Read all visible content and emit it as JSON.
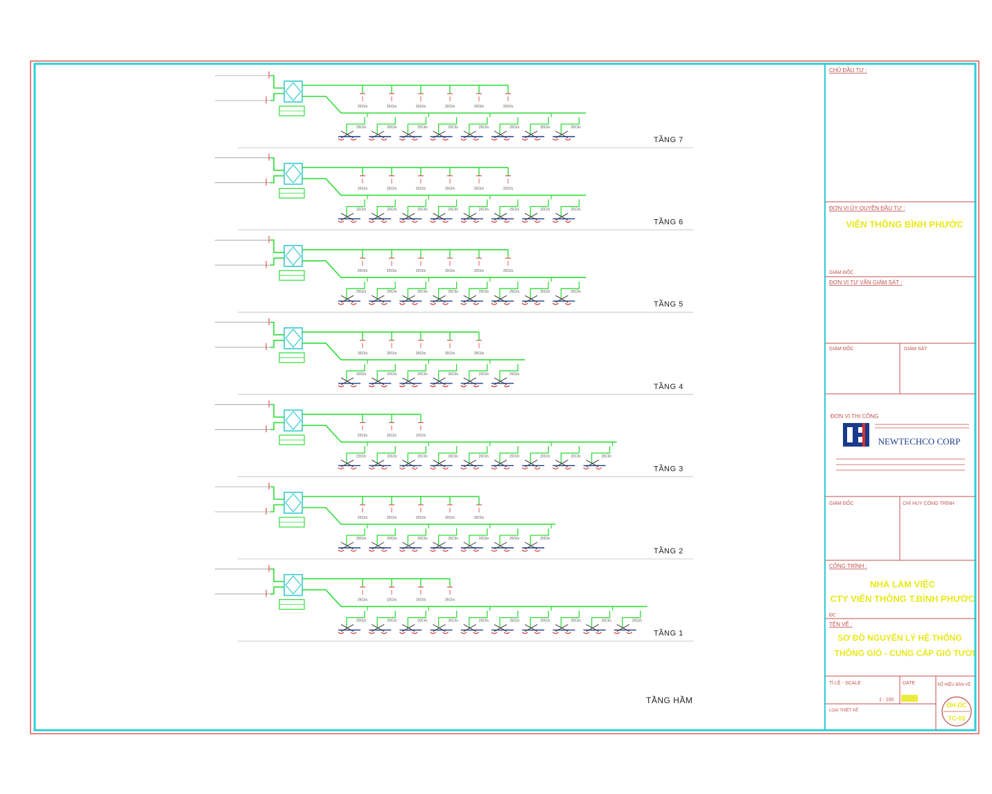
{
  "floors": [
    {
      "label": "TẦNG 7",
      "top_tees": [
        "20Cl/s",
        "20Cl/s",
        "20Cl/s",
        "20Cl/s",
        "20Cl/s",
        "20Cl/s"
      ],
      "bottom_labels": [
        "25Cl/s",
        "25Cl/s",
        "25Cl/s",
        "25Cl/s",
        "25Cl/s",
        "25Cl/s",
        "25Cl/s",
        "25Cl/s"
      ]
    },
    {
      "label": "TẦNG 6",
      "top_tees": [
        "20Cl/s",
        "20Cl/s",
        "20Cl/s",
        "20Cl/s",
        "20Cl/s",
        "20Cl/s"
      ],
      "bottom_labels": [
        "25Cl/s",
        "25Cl/s",
        "25Cl/s",
        "25Cl/s",
        "25Cl/s",
        "25Cl/s",
        "25Cl/s",
        "25Cl/s"
      ]
    },
    {
      "label": "TẦNG 5",
      "top_tees": [
        "20Cl/s",
        "20Cl/s",
        "20Cl/s",
        "20Cl/s",
        "20Cl/s",
        "20Cl/s"
      ],
      "bottom_labels": [
        "25Cl/s",
        "25Cl/s",
        "25Cl/s",
        "25Cl/s",
        "25Cl/s",
        "25Cl/s",
        "25Cl/s",
        "25Cl/s"
      ]
    },
    {
      "label": "TẦNG 4",
      "top_tees": [
        "20Cl/s",
        "20Cl/s",
        "20Cl/s",
        "20Cl/s",
        "20Cl/s"
      ],
      "bottom_labels": [
        "20Cl/s",
        "20Cl/s",
        "20Cl/s",
        "20Cl/s",
        "20Cl/s",
        "20Cl/s"
      ]
    },
    {
      "label": "TẦNG 3",
      "top_tees": [
        "20Cl/s",
        "20Cl/s",
        "10Cl/s"
      ],
      "bottom_labels": [
        "20Cl/s",
        "20Cl/s",
        "20Cl/s",
        "20Cl/s",
        "20Cl/s",
        "20Cl/s",
        "20Cl/s",
        "20Cl/s",
        "20Cl/s"
      ]
    },
    {
      "label": "TẦNG 2",
      "top_tees": [
        "20Cl/s",
        "20Cl/s",
        "20Cl/s",
        "20Cl/s",
        "20Cl/s"
      ],
      "bottom_labels": [
        "20Cl/s",
        "20Cl/s",
        "20Cl/s",
        "25Cl/s",
        "20Cl/s",
        "20Cl/s",
        "20Cl/s"
      ]
    },
    {
      "label": "TẦNG 1",
      "top_tees": [
        "25Cl/s",
        "10Cl/s",
        "10Cl/s",
        "25Cl/s"
      ],
      "bottom_labels": [
        "20Cl/s",
        "20Cl/s",
        "20Cl/s",
        "20Cl/s",
        "25Cl/s",
        "25Cl/s",
        "20Cl/s",
        "20Cl/s",
        "20Cl/s",
        "20Cl/s"
      ]
    }
  ],
  "unit_labels": {
    "upper": "AHU",
    "lower": "1000Cl/s"
  },
  "basement_label": "TẦNG HẦM",
  "title_block": {
    "chu_dau_tu_label": "CHỦ ĐẦU TƯ :",
    "don_vi_uy_quyen_label": "ĐƠN VỊ ỦY QUYỀN ĐẦU TƯ :",
    "don_vi_uy_quyen_value": "VIỄN THÔNG BÌNH PHƯỚC",
    "giam_doc_label_1": "GIÁM ĐỐC",
    "don_vi_tu_van_label": "ĐƠN VỊ TƯ VẤN GIÁM SÁT :",
    "giam_doc_label_2": "GIÁM ĐỐC",
    "giam_sat_label": "GIÁM SÁT",
    "don_vi_thi_cong_label": "ĐƠN VỊ THI CÔNG",
    "company_name": "NEWTECHCO CORP",
    "giam_doc_label_3": "GIÁM ĐỐC",
    "chi_huy_label": "CHỈ HUY CÔNG TRÌNH",
    "cong_trinh_label": "CÔNG TRÌNH :",
    "cong_trinh_line1": "NHÀ LÀM VIỆC",
    "cong_trinh_line2": "CTY VIỄN THÔNG T.BÌNH PHƯỚC",
    "dc_label": "ĐC :",
    "ten_ve_label": "TÊN VẼ :",
    "ten_ve_line1": "SƠ ĐỒ NGUYÊN LÝ HỆ THỐNG",
    "ten_ve_line2": "THÔNG GIÓ - CUNG CẤP GIÓ TƯƠI",
    "scale_label": "TỈ LỆ - SCALE",
    "scale_value": "1 : 100",
    "date_label": "DATE",
    "sheet_label": "SỐ HIỆU BẢN VẼ",
    "sheet_no_1": "ĐH-DC",
    "sheet_no_2": "TC-03",
    "revision_label": "LOẠI THIẾT KẾ"
  },
  "colors": {
    "border_outer": "#d9302e",
    "border_inner": "#2ccfd6",
    "duct": "#2edc36",
    "ahu": "#36c9cc",
    "title_yellow": "#e8e81a",
    "table_line": "#c0504d"
  }
}
